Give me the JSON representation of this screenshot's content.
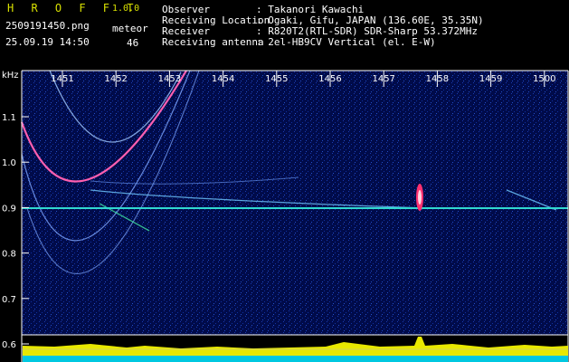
{
  "header": {
    "app_title": "H R O F F T",
    "app_version": "1.0.0",
    "file_name": "2509191450.png",
    "timestamp": "25.09.19 14:50",
    "meteor_label": "meteor",
    "meteor_count": "46"
  },
  "info": [
    {
      "label": "Observer",
      "value": ": Takanori Kawachi"
    },
    {
      "label": "Receiving Location",
      "value": ": Ogaki, Gifu, JAPAN (136.60E, 35.35N)"
    },
    {
      "label": "Receiver",
      "value": ": R820T2(RTL-SDR) SDR-Sharp 53.372MHz"
    },
    {
      "label": "Receiving antenna",
      "value": ": 2el-HB9CV Vertical (el. E-W)"
    }
  ],
  "chart_data": {
    "type": "heatmap",
    "ylabel": "kHz",
    "x_ticks": [
      "1451",
      "1452",
      "1453",
      "1454",
      "1455",
      "1456",
      "1457",
      "1458",
      "1459",
      "1500"
    ],
    "y_ticks": [
      "1.1",
      "1.0",
      "0.9",
      "0.8",
      "0.7",
      "0.6"
    ],
    "ylim": [
      0.6,
      1.15
    ],
    "colors": {
      "background": "#000b4a",
      "carrier": "#30d8d0",
      "echo": "#ff4fa0",
      "meter_bar": "#e8e800",
      "meter_base": "#00c8e0"
    }
  }
}
